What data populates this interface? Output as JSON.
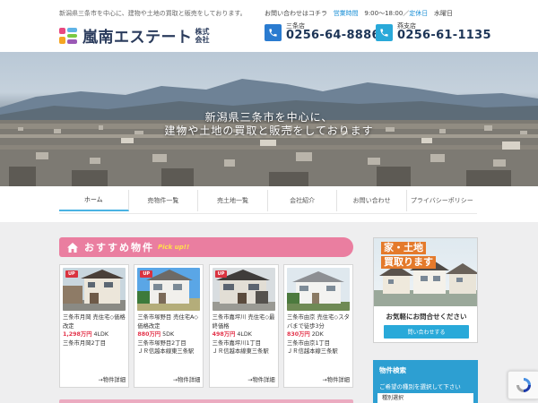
{
  "header": {
    "tagline": "新潟県三条市を中心に、建物や土地の買取と販売をしております。",
    "logo_name": "嵐南エステート",
    "logo_suffix_1": "株式",
    "logo_suffix_2": "会社",
    "contact_prefix": "お問い合わせはコチラ",
    "hours_label": "営業時間",
    "hours_value": "9:00～18:00／",
    "holiday_label": "定休日",
    "holiday_value": "水曜日",
    "stores": [
      {
        "name": "三条店",
        "tel": "0256-64-8886"
      },
      {
        "name": "燕支店",
        "tel": "0256-61-1135"
      }
    ]
  },
  "hero": {
    "line1": "新潟県三条市を中心に、",
    "line2": "建物や土地の買取と販売をしております"
  },
  "nav": {
    "items": [
      "ホーム",
      "売物件一覧",
      "売土地一覧",
      "会社紹介",
      "お問い合わせ",
      "プライバシーポリシー"
    ],
    "active_index": 0
  },
  "recommended": {
    "title": "おすすめ物件",
    "pick": "Pick up!!",
    "detail_label": "→物件詳細",
    "properties": [
      {
        "badge": "UP",
        "title": "三条市月岡 売住宅◇価格改定",
        "price": "1,298万円",
        "layout": "4LDK",
        "address": "三条市月岡2丁目"
      },
      {
        "badge": "UP",
        "title": "三条市塚野目 売住宅A◇価格改定",
        "price": "880万円",
        "layout": "5DK",
        "address": "三条市塚野目2丁目",
        "station": "ＪＲ信越本線東三条駅"
      },
      {
        "badge": "UP",
        "title": "三条市嘉坪川 売住宅◇最終価格",
        "price": "498万円",
        "layout": "4LDK",
        "address": "三条市嘉坪川1丁目",
        "station": "ＪＲ信越本線東三条駅"
      },
      {
        "badge": "",
        "title": "三条市由京 売住宅◇スタバまで徒歩3分",
        "price": "830万円",
        "layout": "2DK",
        "address": "三条市由京1丁目",
        "station": "ＪＲ信越本線三条駅"
      }
    ]
  },
  "sidebar": {
    "banner_line1": "家・土地",
    "banner_line2": "買取ります",
    "ask_text": "お気軽にお問合せください",
    "button_label": "問い合わせする",
    "search_title": "物件検索",
    "search_desc": "ご希望の種別を選択して下さい",
    "select_value": "種別選択"
  },
  "colors": {
    "accent_blue": "#29a9d9",
    "pink": "#ea7ea0",
    "price_red": "#e3344b",
    "navy": "#1d3557"
  }
}
